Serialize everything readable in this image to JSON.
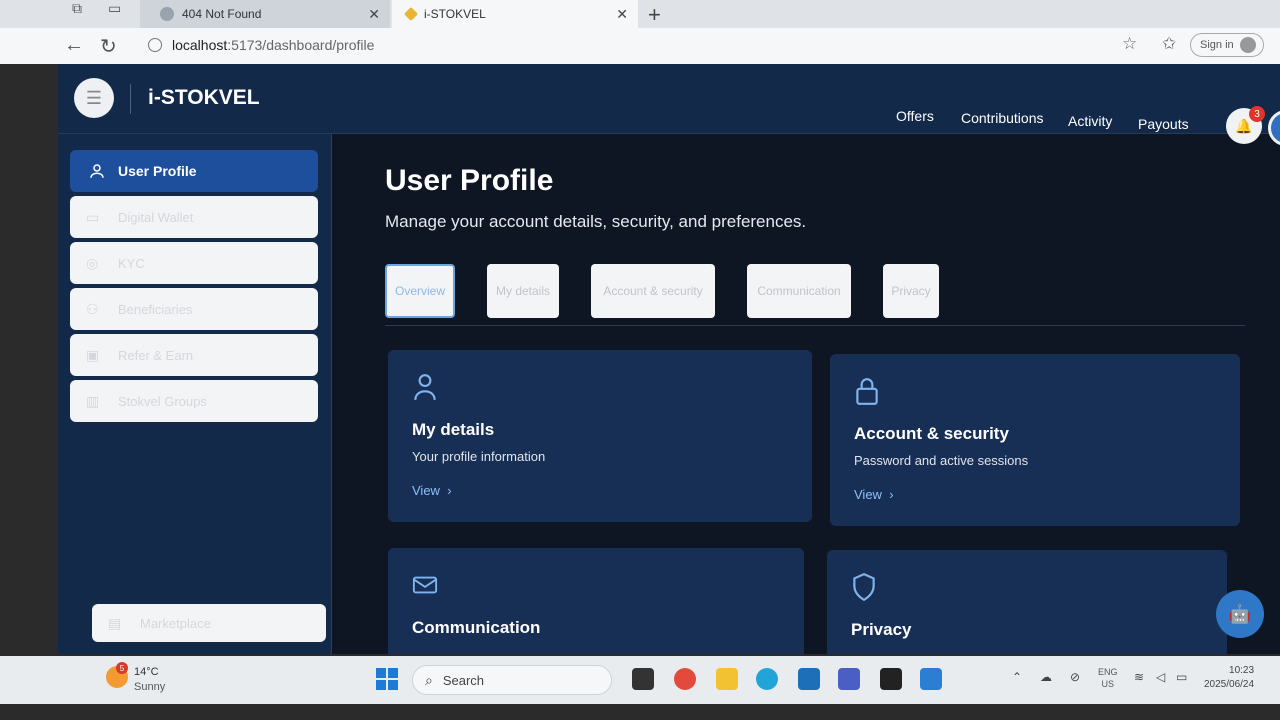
{
  "browser": {
    "tabs": [
      {
        "label": "404 Not Found",
        "active": false
      },
      {
        "label": "i-STOKVEL",
        "active": true
      }
    ],
    "url_host": "localhost",
    "url_path": ":5173/dashboard/profile",
    "signin_label": "Sign in"
  },
  "app": {
    "brand": "i-STOKVEL",
    "nav": [
      "Offers",
      "Contributions",
      "Activity",
      "Payouts"
    ],
    "notification_count": "3"
  },
  "sidebar": {
    "items": [
      {
        "label": "User Profile",
        "icon": "user-icon",
        "active": true
      },
      {
        "label": "Digital Wallet",
        "icon": "wallet-icon",
        "active": false
      },
      {
        "label": "KYC",
        "icon": "check-circle-icon",
        "active": false
      },
      {
        "label": "Beneficiaries",
        "icon": "users-icon",
        "active": false
      },
      {
        "label": "Refer & Earn",
        "icon": "gift-icon",
        "active": false
      },
      {
        "label": "Stokvel Groups",
        "icon": "building-icon",
        "active": false
      }
    ],
    "bottom_item": {
      "label": "Marketplace",
      "icon": "store-icon"
    }
  },
  "main": {
    "title": "User Profile",
    "subtitle": "Manage your account details, security, and preferences.",
    "tabs": [
      "Overview",
      "My details",
      "Account & security",
      "Communication",
      "Privacy"
    ],
    "active_tab": "Overview",
    "cards": [
      {
        "title": "My details",
        "desc": "Your profile information",
        "link": "View",
        "icon": "user-icon"
      },
      {
        "title": "Account & security",
        "desc": "Password and active sessions",
        "link": "View",
        "icon": "lock-icon"
      },
      {
        "title": "Communication",
        "desc": "",
        "link": "",
        "icon": "mail-icon"
      },
      {
        "title": "Privacy",
        "desc": "",
        "link": "",
        "icon": "shield-icon"
      }
    ]
  },
  "taskbar": {
    "weather_temp": "14°C",
    "weather_cond": "Sunny",
    "weather_badge": "5",
    "search_placeholder": "Search",
    "lang_1": "ENG",
    "lang_2": "US",
    "time": "10:23",
    "date": "2025/06/24"
  },
  "colors": {
    "accent": "#1e4f9c",
    "header_bg": "#12294a",
    "card_bg": "#182f55",
    "link": "#8cc0f5"
  }
}
